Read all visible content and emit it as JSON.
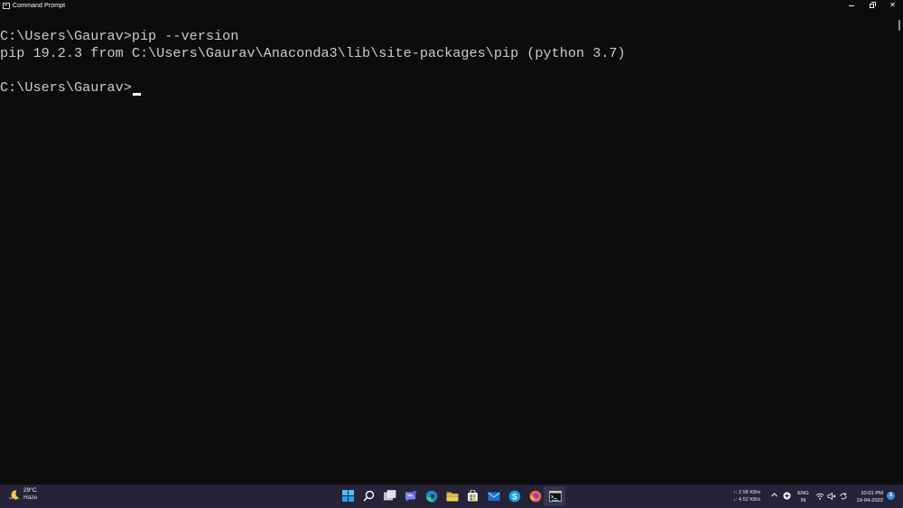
{
  "window": {
    "title": "Command Prompt",
    "minimize_glyph": "–",
    "close_glyph": "✕"
  },
  "console": {
    "lines": [
      "C:\\Users\\Gaurav>pip --version",
      "pip 19.2.3 from C:\\Users\\Gaurav\\Anaconda3\\lib\\site-packages\\pip (python 3.7)",
      "",
      "C:\\Users\\Gaurav>"
    ],
    "text_color": "#cccccc",
    "background": "#0c0c0c"
  },
  "taskbar": {
    "weather": {
      "temperature": "29°C",
      "condition": "Haze",
      "icon": "moon-icon"
    },
    "apps": [
      {
        "name": "start",
        "icon": "windows-logo-icon"
      },
      {
        "name": "search",
        "icon": "search-icon"
      },
      {
        "name": "task-view",
        "icon": "task-view-icon"
      },
      {
        "name": "teams-chat",
        "icon": "chat-icon"
      },
      {
        "name": "edge",
        "icon": "edge-icon"
      },
      {
        "name": "file-explorer",
        "icon": "folder-icon"
      },
      {
        "name": "store",
        "icon": "store-icon"
      },
      {
        "name": "mail",
        "icon": "mail-icon"
      },
      {
        "name": "skype",
        "icon": "skype-icon"
      },
      {
        "name": "firefox",
        "icon": "firefox-icon"
      },
      {
        "name": "command-prompt",
        "icon": "terminal-icon"
      }
    ],
    "network_speed": {
      "upload": "↑: 2.58 KB/s",
      "download": "↓: 4.52 KB/s"
    },
    "language": {
      "line1": "ENG",
      "line2": "IN"
    },
    "clock": {
      "time": "10:01 PM",
      "date": "19-04-2022"
    },
    "notifications": "1",
    "background": "#262238"
  }
}
